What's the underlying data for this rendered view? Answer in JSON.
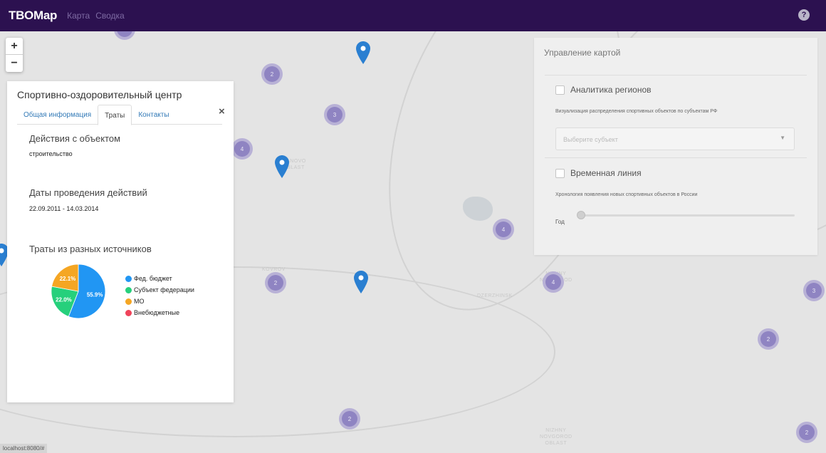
{
  "navbar": {
    "brand": "TBOMap",
    "links": [
      "Карта",
      "Сводка"
    ],
    "help_icon": "?"
  },
  "zoom": {
    "in": "+",
    "out": "−"
  },
  "map": {
    "labels": [
      "IVANOVO\nOBLAST",
      "KOVROV",
      "DZERZHINSK",
      "NIZHNY\nNOVGOROD",
      "NIZHNY\nNOVGOROD\nOBLAST"
    ],
    "cluster_counts": [
      "2",
      "2",
      "3",
      "4",
      "4",
      "2",
      "4",
      "3",
      "2",
      "2",
      "2"
    ],
    "marker_icon": "map-pin-icon"
  },
  "info_panel": {
    "title": "Спортивно-оздоровительный центр",
    "tabs": [
      "Общая информация",
      "Траты",
      "Контакты"
    ],
    "active_tab": "Траты",
    "actions_heading": "Действия с объектом",
    "actions_value": "строительство",
    "dates_heading": "Даты проведения действий",
    "dates_value": "22.09.2011 - 14.03.2014",
    "spend_heading": "Траты из разных источников"
  },
  "chart_data": {
    "type": "pie",
    "categories": [
      "Фед. бюджет",
      "Субъект федерации",
      "МО",
      "Внебюджетные"
    ],
    "values": [
      55.9,
      22.0,
      22.1,
      0
    ],
    "labels": [
      "55.9%",
      "22.0%",
      "22.1%",
      ""
    ],
    "colors": [
      "#2196f3",
      "#26d07c",
      "#f5a623",
      "#f0435a"
    ],
    "legend_placement": "right"
  },
  "control_panel": {
    "title": "Управление картой",
    "analytics_label": "Аналитика регионов",
    "analytics_desc": "Визуализация распределения спортивных объектов по субъектам РФ",
    "select_placeholder": "Выберите субъект",
    "timeline_label": "Временная линия",
    "timeline_desc": "Хронология появления новых спортивных объектов в России",
    "year_label": "Год"
  },
  "status_bar": "localhost:8080/#",
  "colors": {
    "navbar": "#2c1150",
    "cluster": "#8f84c2",
    "marker": "#2a7fd1"
  }
}
